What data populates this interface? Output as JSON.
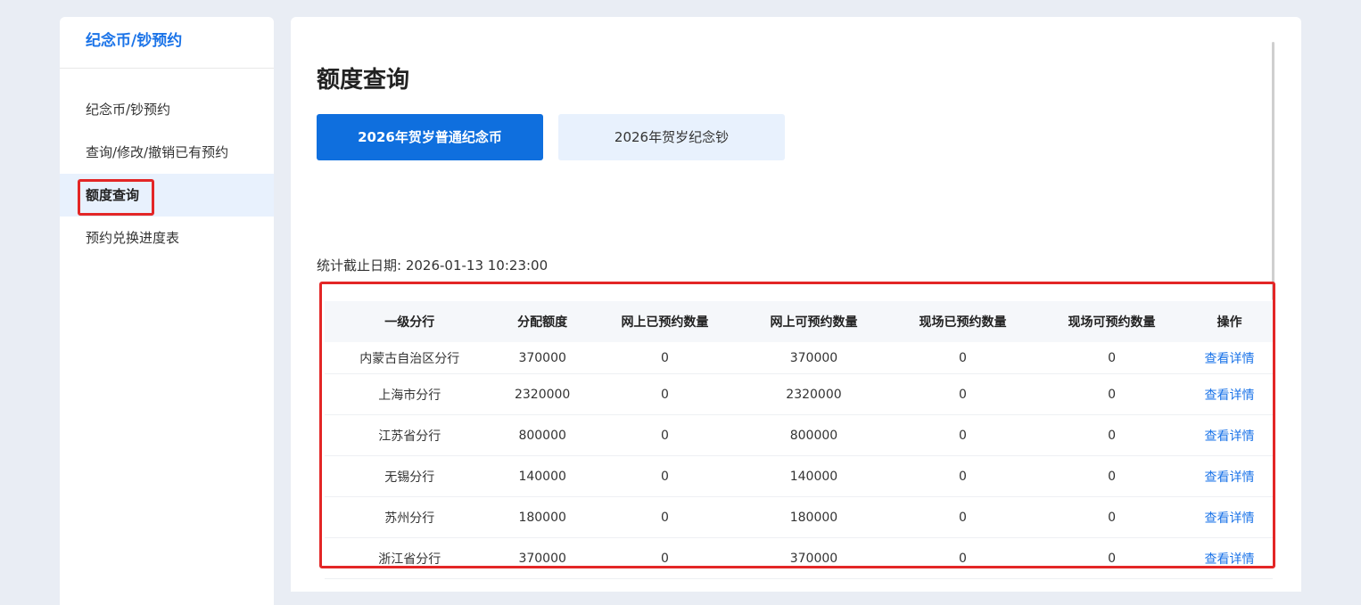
{
  "sidebar": {
    "title": "纪念币/钞预约",
    "items": [
      {
        "label": "纪念币/钞预约"
      },
      {
        "label": "查询/修改/撤销已有预约"
      },
      {
        "label": "额度查询"
      },
      {
        "label": "预约兑换进度表"
      }
    ]
  },
  "main": {
    "title": "额度查询",
    "tabs": [
      {
        "label": "2026年贺岁普通纪念币"
      },
      {
        "label": "2026年贺岁纪念钞"
      }
    ],
    "stat_date": "统计截止日期: 2026-01-13 10:23:00"
  },
  "table": {
    "headers": [
      "一级分行",
      "分配额度",
      "网上已预约数量",
      "网上可预约数量",
      "现场已预约数量",
      "现场可预约数量",
      "操作"
    ],
    "rows": [
      [
        "内蒙古自治区分行",
        "370000",
        "0",
        "370000",
        "0",
        "0",
        "查看详情"
      ],
      [
        "上海市分行",
        "2320000",
        "0",
        "2320000",
        "0",
        "0",
        "查看详情"
      ],
      [
        "江苏省分行",
        "800000",
        "0",
        "800000",
        "0",
        "0",
        "查看详情"
      ],
      [
        "无锡分行",
        "140000",
        "0",
        "140000",
        "0",
        "0",
        "查看详情"
      ],
      [
        "苏州分行",
        "180000",
        "0",
        "180000",
        "0",
        "0",
        "查看详情"
      ],
      [
        "浙江省分行",
        "370000",
        "0",
        "370000",
        "0",
        "0",
        "查看详情"
      ]
    ]
  },
  "colors": {
    "accent": "#0f6fde",
    "link": "#1a73e8",
    "highlight": "#e32626",
    "active_nav_bg": "#e8f1fd"
  }
}
